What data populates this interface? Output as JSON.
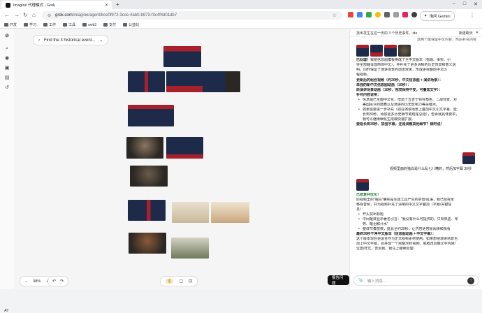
{
  "browser": {
    "tab_title": "Imagine 代理模式 - Grok",
    "url_host": "grok.com",
    "url_path": "/imagine/agent/bce0f972-3cce-4ab0-b973-f3c4f4d01db7",
    "gemini_label": "询问 Gemini",
    "bookmarks": [
      "开发",
      "学习",
      "工作",
      "工具",
      "web3",
      "支付",
      "公益站"
    ]
  },
  "canvas": {
    "prompt_title": "Find the 3 historical event...",
    "zoom_level": "38%",
    "report_label": "报告问题",
    "at_label": "AT"
  },
  "panel": {
    "header_title": "找出发生在这一天的 3 个历史事件。ide",
    "new_chat_label": "新建聊天",
    "top_fragment": "这两个能保留中文内容，然后补充内容",
    "msg1": {
      "lead_bold": "已处理！",
      "lines": [
        "我把信息图模板换成了全中文版本（标题、事实、引",
        "导全部翻译成简体中文），并补充了更多清晰的历史背景和意义说",
        "明。同时保留了演讲场景的动态效果，形成更完整的中文历",
        "程视频。"
      ],
      "section1": "更新后的组合视频（约20秒，中文信息图 + 演讲场景）：",
      "item1": "单独的新中文信息图动画（10秒）：",
      "item2": "原演讲场景动画（10秒，视觉保持不变，可叠加文字）：",
      "item3": "补充内容说明：",
      "bullets": [
        "信息图已全面中文化，增加了五吉宁领导角色、二战背景、对",
        "美国民众的鼓舞以及演讲的历史影响力等关键点。",
        "如果需要进一步补充（如在演讲场景上叠加中文引文字幕、延",
        "长到30秒、添加更多历史细节或结尾总结），告诉我具体要求，",
        "我可以继续细化生成或快速扩展。"
      ],
      "closing": "要延长到30秒、加强字幕，还是调整其他细节？随时说！"
    },
    "user_msg": "视频里面的独白是什么乱七八糟的，然后加字幕 30秒",
    "msg2": {
      "lead": "已修复并优化！",
      "lines": [
        "原视频里的\"独白\"确实是生成工具产生的杂音/乱语，我已经完全",
        "移除音频，并为视频补充了清晰的中文文字叠加（字幕/关键信",
        "息）："
      ],
      "bullets": [
        "开头突出标题",
        "中间醒目显示著名引言：\"我没有什么可提供的，只有热血、辛",
        "劳、眼泪和汗水\"",
        "整体节奏放慢，延长至约30秒，让内容更容易阅读和观看"
      ],
      "section": "最终30秒干净中文版本（信息图动画 + 中文字幕）：",
      "tail": [
        "这个版本现在更适合作为正式视频素材使用。如果想把演讲场景也",
        "加上中文字幕，合并成一个完整30秒视频，或者再调整文字内容/",
        "位置/样式，告诉我，我马上继续处理！"
      ]
    },
    "input_placeholder": "输入消息..."
  },
  "colors": {
    "navy": "#1d2a4a",
    "red": "#a6212b",
    "sepia": "#c9b99a",
    "dark": "#2b2723"
  }
}
